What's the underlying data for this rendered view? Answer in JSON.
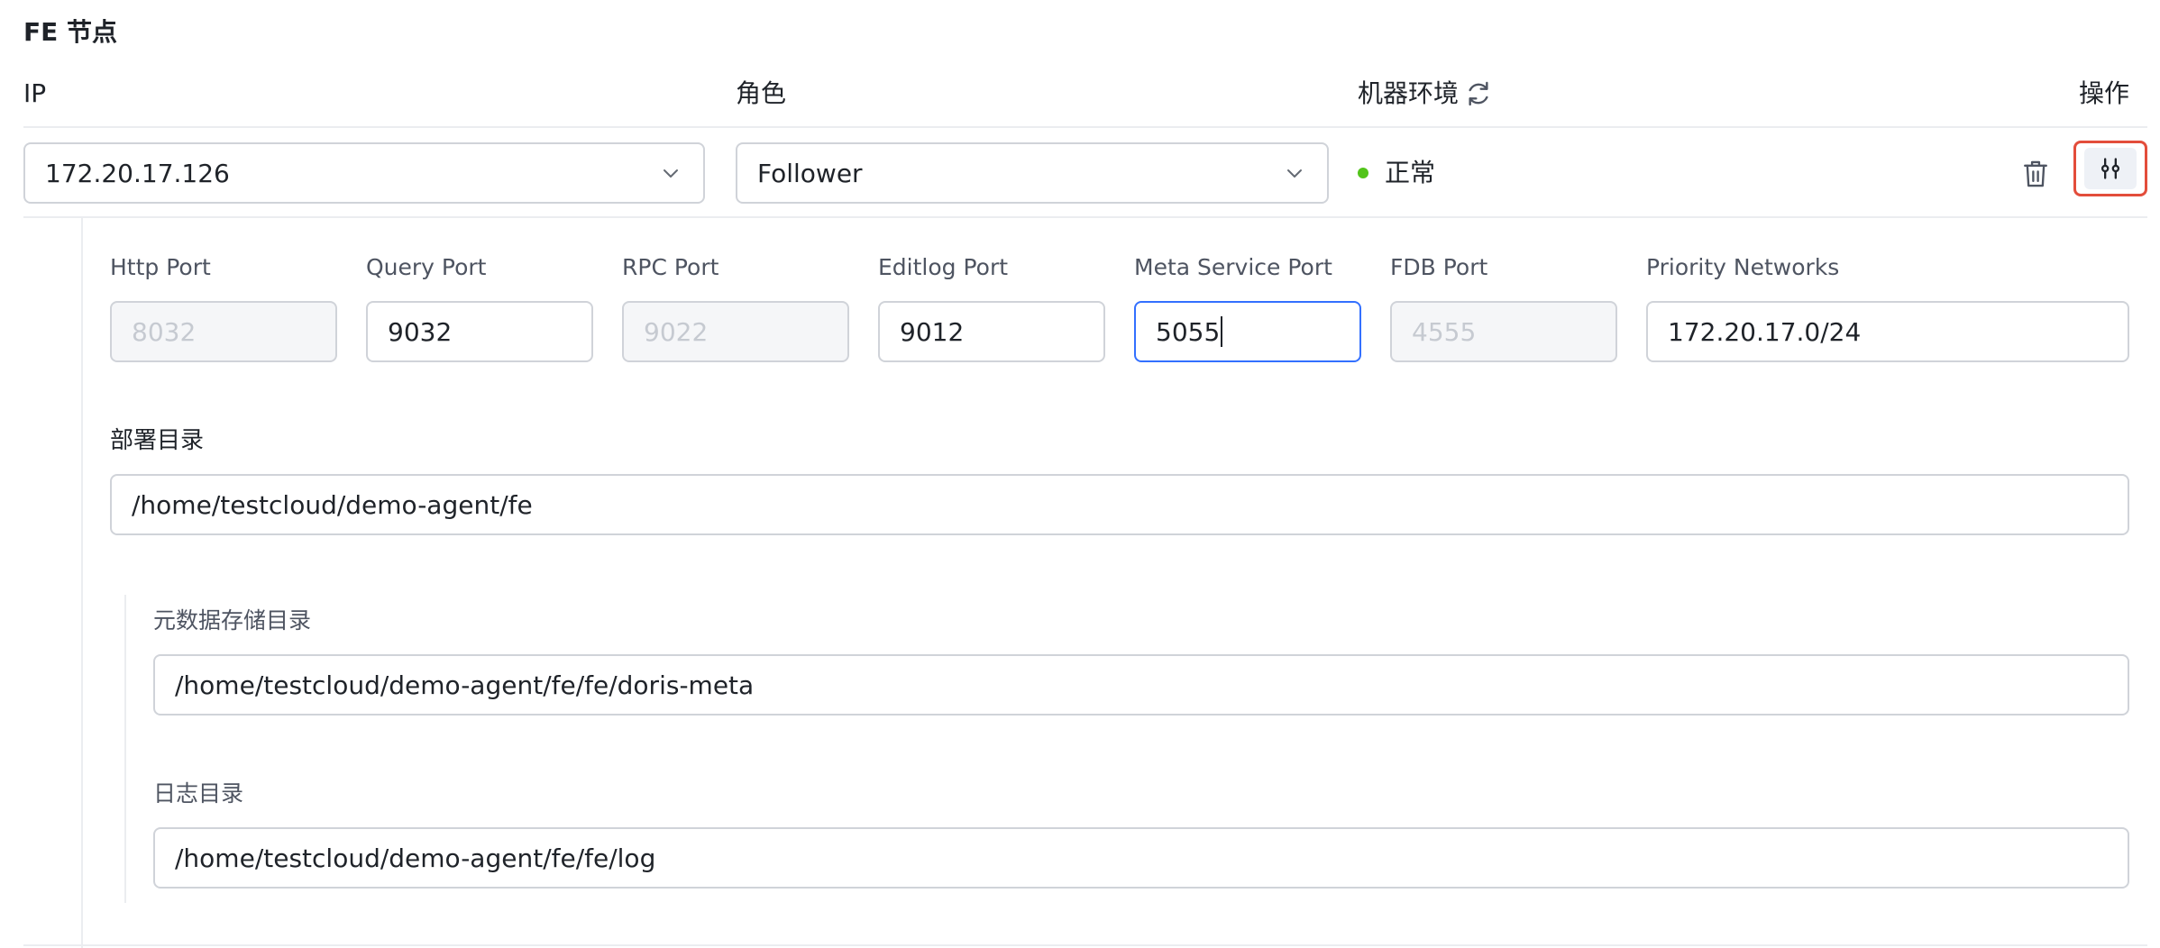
{
  "section": {
    "title": "FE 节点"
  },
  "columns": {
    "ip": "IP",
    "role": "角色",
    "env": "机器环境",
    "actions": "操作"
  },
  "row": {
    "ip_value": "172.20.17.126",
    "role_value": "Follower",
    "status_text": "正常",
    "status_color": "#52c41a"
  },
  "ports": {
    "http_port": {
      "label": "Http Port",
      "value": "8032"
    },
    "query_port": {
      "label": "Query Port",
      "value": "9032"
    },
    "rpc_port": {
      "label": "RPC Port",
      "value": "9022"
    },
    "editlog_port": {
      "label": "Editlog Port",
      "value": "9012"
    },
    "meta_service_port": {
      "label": "Meta Service Port",
      "value": "5055"
    },
    "fdb_port": {
      "label": "FDB Port",
      "value": "4555"
    },
    "priority_networks": {
      "label": "Priority Networks",
      "value": "172.20.17.0/24"
    }
  },
  "deploy_dir": {
    "label": "部署目录",
    "value": "/home/testcloud/demo-agent/fe"
  },
  "meta_dir": {
    "label": "元数据存储目录",
    "value": "/home/testcloud/demo-agent/fe/fe/doris-meta"
  },
  "log_dir": {
    "label": "日志目录",
    "value": "/home/testcloud/demo-agent/fe/fe/log"
  },
  "icons": {
    "refresh": "refresh-icon",
    "chevron": "chevron-down-icon",
    "trash": "trash-icon",
    "settings": "sliders-icon"
  },
  "colors": {
    "focus_border": "#3370ff",
    "highlight_border": "#e34d3b"
  }
}
